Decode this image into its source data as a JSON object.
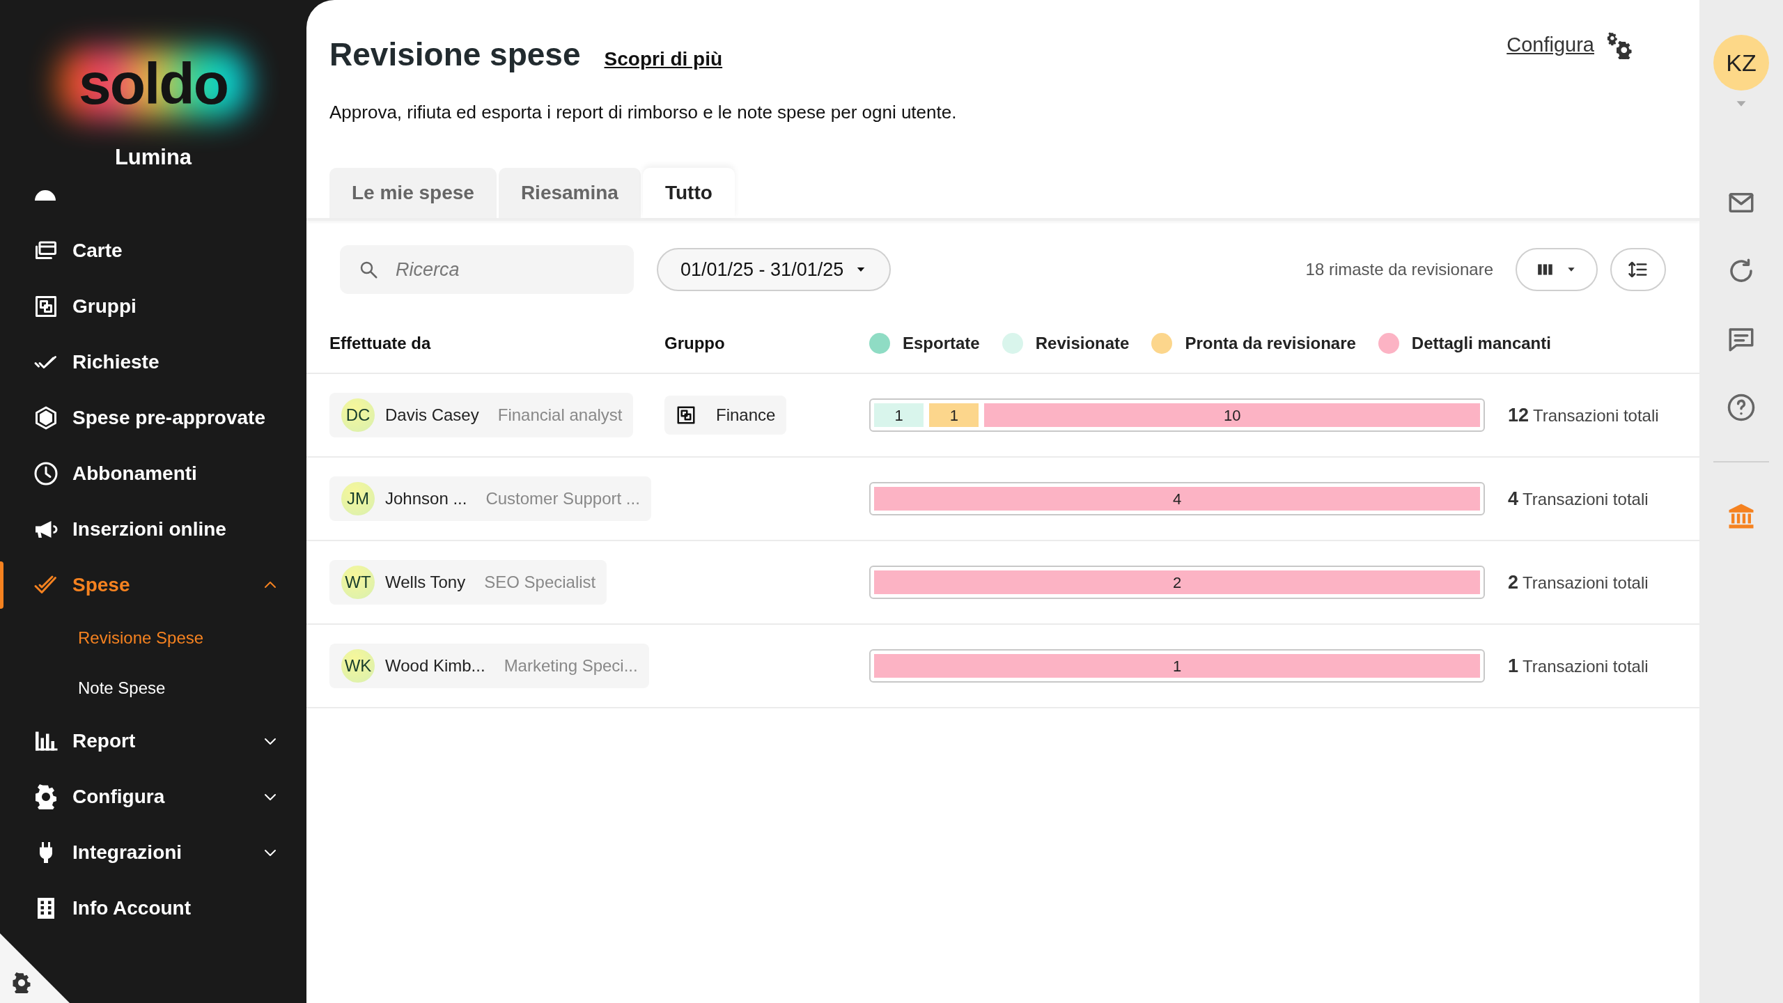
{
  "sidebar": {
    "logo": "soldo",
    "company": "Lumina",
    "items": [
      {
        "label": "Carte",
        "selected": false
      },
      {
        "label": "Gruppi",
        "selected": false
      },
      {
        "label": "Richieste",
        "selected": false
      },
      {
        "label": "Spese pre-approvate",
        "selected": false
      },
      {
        "label": "Abbonamenti",
        "selected": false
      },
      {
        "label": "Inserzioni online",
        "selected": false
      },
      {
        "label": "Spese",
        "selected": true,
        "expanded": true,
        "children": [
          {
            "label": "Revisione Spese",
            "selected": true
          },
          {
            "label": "Note Spese",
            "selected": false
          }
        ]
      },
      {
        "label": "Report",
        "selected": false,
        "expanded": false
      },
      {
        "label": "Configura",
        "selected": false,
        "expanded": false
      },
      {
        "label": "Integrazioni",
        "selected": false,
        "expanded": false
      },
      {
        "label": "Info Account",
        "selected": false
      }
    ]
  },
  "header": {
    "title": "Revisione spese",
    "link": "Scopri di più",
    "configure_link": "Configura",
    "subtitle": "Approva, rifiuta ed esporta i report di rimborso e le note spese per ogni utente."
  },
  "tabs": [
    {
      "label": "Le mie spese",
      "selected": false
    },
    {
      "label": "Riesamina",
      "selected": false
    },
    {
      "label": "Tutto",
      "selected": true
    }
  ],
  "toolbar": {
    "search": {
      "placeholder": "Ricerca"
    },
    "date_range": "01/01/25 - 31/01/25",
    "remaining": "18 rimaste da revisionare"
  },
  "table": {
    "columns": [
      "Effettuate da",
      "Gruppo"
    ],
    "legend": [
      {
        "kind": "exported",
        "label": "Esportate",
        "color": "#8fdcc4"
      },
      {
        "kind": "reviewed",
        "label": "Revisionate",
        "color": "#d9f5ec"
      },
      {
        "kind": "ready",
        "label": "Pronta da revisionare",
        "color": "#fcd68c"
      },
      {
        "kind": "missing",
        "label": "Dettagli mancanti",
        "color": "#fcb3c4"
      }
    ],
    "rows": [
      {
        "initials": "DC",
        "name": "Davis Casey",
        "role": "Financial analyst",
        "group": "Finance",
        "segments": [
          {
            "kind": "reviewed",
            "count": "1"
          },
          {
            "kind": "ready",
            "count": "1"
          },
          {
            "kind": "missing",
            "count": "10"
          }
        ],
        "total": "12",
        "total_label": "Transazioni totali"
      },
      {
        "initials": "JM",
        "name": "Johnson ...",
        "role": "Customer Support ...",
        "segments": [
          {
            "kind": "missing",
            "count": "4"
          }
        ],
        "total": "4",
        "total_label": "Transazioni totali"
      },
      {
        "initials": "WT",
        "name": "Wells Tony",
        "role": "SEO Specialist",
        "segments": [
          {
            "kind": "missing",
            "count": "2"
          }
        ],
        "total": "2",
        "total_label": "Transazioni totali"
      },
      {
        "initials": "WK",
        "name": "Wood Kimb...",
        "role": "Marketing Speci...",
        "segments": [
          {
            "kind": "missing",
            "count": "1"
          }
        ],
        "total": "1",
        "total_label": "Transazioni totali"
      }
    ]
  },
  "user": {
    "initials": "KZ"
  }
}
